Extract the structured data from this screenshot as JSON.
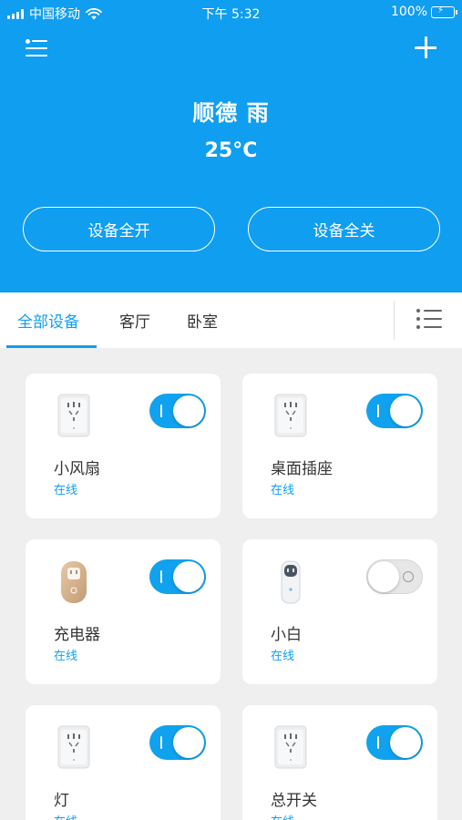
{
  "status_bar": {
    "carrier": "中国移动",
    "time": "下午 5:32",
    "battery": "100%"
  },
  "header": {
    "city_weather": "顺德 雨",
    "temperature": "25°C",
    "all_on_label": "设备全开",
    "all_off_label": "设备全关",
    "menu_icon": "menu-list-icon",
    "add_icon": "plus-icon"
  },
  "tabs": [
    {
      "label": "全部设备",
      "active": true
    },
    {
      "label": "客厅",
      "active": false
    },
    {
      "label": "卧室",
      "active": false
    }
  ],
  "devices": [
    {
      "name": "小风扇",
      "status": "在线",
      "power": true,
      "plug_style": "white"
    },
    {
      "name": "桌面插座",
      "status": "在线",
      "power": true,
      "plug_style": "white"
    },
    {
      "name": "充电器",
      "status": "在线",
      "power": true,
      "plug_style": "gold"
    },
    {
      "name": "小白",
      "status": "在线",
      "power": false,
      "plug_style": "slim"
    },
    {
      "name": "灯",
      "status": "在线",
      "power": true,
      "plug_style": "white"
    },
    {
      "name": "总开关",
      "status": "在线",
      "power": true,
      "plug_style": "white"
    }
  ],
  "colors": {
    "primary": "#109ef0",
    "toggle_on": "#10a2ee",
    "background": "#efeff0"
  }
}
